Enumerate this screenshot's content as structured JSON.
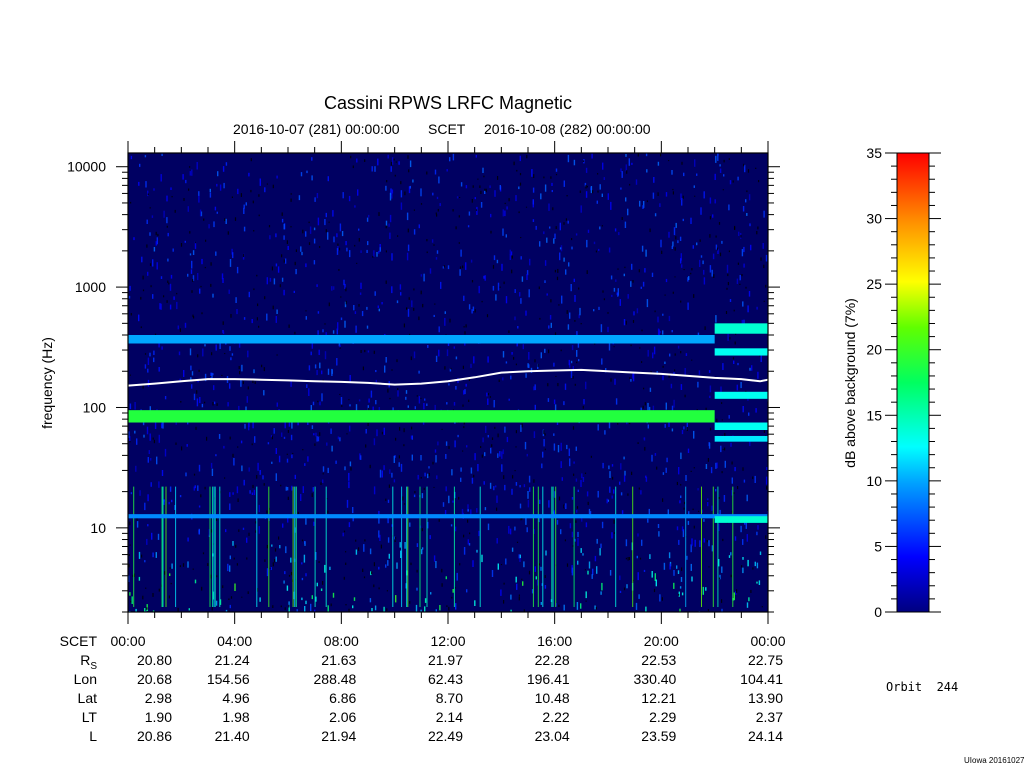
{
  "chart_data": {
    "type": "heatmap",
    "title": "Cassini RPWS LRFC Magnetic",
    "subtitle_start": "2016-10-07 (281) 00:00:00",
    "subtitle_mid": "SCET",
    "subtitle_end": "2016-10-08 (282) 00:00:00",
    "ylabel": "frequency (Hz)",
    "y_scale": "log",
    "ylim": [
      2,
      13000
    ],
    "y_ticks": [
      {
        "value": 10,
        "label": "10"
      },
      {
        "value": 100,
        "label": "100"
      },
      {
        "value": 1000,
        "label": "1000"
      },
      {
        "value": 10000,
        "label": "10000"
      }
    ],
    "x_range_hours": [
      0,
      24
    ],
    "x_ticks": [
      {
        "hour": 0,
        "label": "00:00"
      },
      {
        "hour": 4,
        "label": "04:00"
      },
      {
        "hour": 8,
        "label": "08:00"
      },
      {
        "hour": 12,
        "label": "12:00"
      },
      {
        "hour": 16,
        "label": "16:00"
      },
      {
        "hour": 20,
        "label": "20:00"
      },
      {
        "hour": 24,
        "label": "00:00"
      }
    ],
    "colorbar": {
      "label": "dB above background (7%)",
      "range": [
        0,
        35
      ],
      "ticks": [
        "0",
        "5",
        "10",
        "15",
        "20",
        "25",
        "30",
        "35"
      ]
    },
    "bands": [
      {
        "f_low": 75,
        "f_high": 95,
        "t_start": 0,
        "t_end": 22,
        "level": 19
      },
      {
        "f_low": 340,
        "f_high": 400,
        "t_start": 0,
        "t_end": 22,
        "level": 10
      },
      {
        "f_low": 410,
        "f_high": 500,
        "t_start": 22,
        "t_end": 24,
        "level": 14
      },
      {
        "f_low": 270,
        "f_high": 310,
        "t_start": 22,
        "t_end": 24,
        "level": 13
      },
      {
        "f_low": 118,
        "f_high": 135,
        "t_start": 22,
        "t_end": 24,
        "level": 13
      },
      {
        "f_low": 65,
        "f_high": 75,
        "t_start": 22,
        "t_end": 24,
        "level": 13
      },
      {
        "f_low": 52,
        "f_high": 58,
        "t_start": 22,
        "t_end": 24,
        "level": 12
      },
      {
        "f_low": 12,
        "f_high": 13,
        "t_start": 0,
        "t_end": 24,
        "level": 9
      },
      {
        "f_low": 11,
        "f_high": 12.5,
        "t_start": 22,
        "t_end": 24,
        "level": 14
      }
    ],
    "fce_line": {
      "color": "#ffffff",
      "points": [
        [
          0,
          152
        ],
        [
          1,
          158
        ],
        [
          2,
          165
        ],
        [
          3,
          172
        ],
        [
          4,
          172
        ],
        [
          5,
          170
        ],
        [
          6,
          168
        ],
        [
          7,
          165
        ],
        [
          8,
          163
        ],
        [
          9,
          160
        ],
        [
          10,
          155
        ],
        [
          11,
          158
        ],
        [
          12,
          165
        ],
        [
          13,
          178
        ],
        [
          14,
          195
        ],
        [
          15,
          200
        ],
        [
          16,
          203
        ],
        [
          17,
          205
        ],
        [
          18,
          200
        ],
        [
          19,
          195
        ],
        [
          20,
          190
        ],
        [
          21,
          183
        ],
        [
          22,
          176
        ],
        [
          23,
          172
        ],
        [
          23.7,
          165
        ],
        [
          24,
          170
        ]
      ]
    }
  },
  "ephemeris": {
    "rows": [
      {
        "label": "SCET",
        "values": [
          "00:00",
          "04:00",
          "08:00",
          "12:00",
          "16:00",
          "20:00",
          "00:00"
        ]
      },
      {
        "label": "R",
        "sub": "S",
        "values": [
          "20.80",
          "21.24",
          "21.63",
          "21.97",
          "22.28",
          "22.53",
          "22.75"
        ]
      },
      {
        "label": "Lon",
        "values": [
          "20.68",
          "154.56",
          "288.48",
          "62.43",
          "196.41",
          "330.40",
          "104.41"
        ]
      },
      {
        "label": "Lat",
        "values": [
          "2.98",
          "4.96",
          "6.86",
          "8.70",
          "10.48",
          "12.21",
          "13.90"
        ]
      },
      {
        "label": "LT",
        "values": [
          "1.90",
          "1.98",
          "2.06",
          "2.14",
          "2.22",
          "2.29",
          "2.37"
        ]
      },
      {
        "label": "L",
        "values": [
          "20.86",
          "21.40",
          "21.94",
          "22.49",
          "23.04",
          "23.59",
          "24.14"
        ]
      }
    ]
  },
  "orbit_label": "Orbit  244",
  "footer": "UIowa 20161027"
}
